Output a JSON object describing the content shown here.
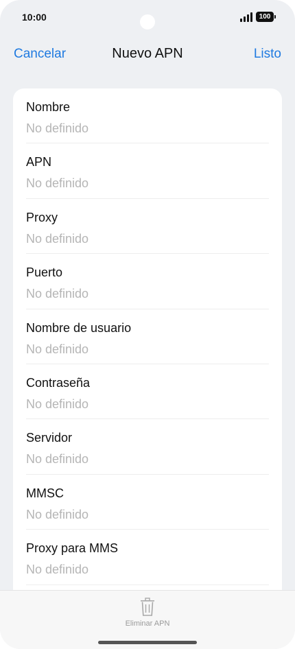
{
  "status_bar": {
    "time": "10:00",
    "battery": "100"
  },
  "nav": {
    "cancel_label": "Cancelar",
    "title": "Nuevo APN",
    "done_label": "Listo"
  },
  "fields": [
    {
      "label": "Nombre",
      "value": "No definido"
    },
    {
      "label": "APN",
      "value": "No definido"
    },
    {
      "label": "Proxy",
      "value": "No definido"
    },
    {
      "label": "Puerto",
      "value": "No definido"
    },
    {
      "label": "Nombre de usuario",
      "value": "No definido"
    },
    {
      "label": "Contraseña",
      "value": "No definido"
    },
    {
      "label": "Servidor",
      "value": "No definido"
    },
    {
      "label": "MMSC",
      "value": "No definido"
    },
    {
      "label": "Proxy para MMS",
      "value": "No definido"
    }
  ],
  "bottom_bar": {
    "delete_label": "Eliminar APN",
    "icon": "trash-icon"
  },
  "colors": {
    "accent": "#1f7ae0",
    "background": "#eef0f3",
    "card": "#ffffff",
    "placeholder": "#b5b5b5"
  }
}
